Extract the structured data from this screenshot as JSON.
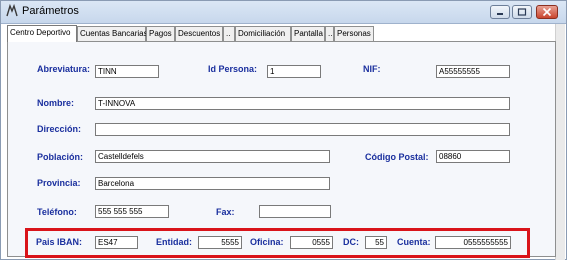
{
  "window": {
    "title": "Parámetros"
  },
  "tabs": [
    {
      "label": "Centro Deportivo",
      "active": true
    },
    {
      "label": "Cuentas Bancarias",
      "active": false
    },
    {
      "label": "Pagos",
      "active": false
    },
    {
      "label": "Descuentos",
      "active": false
    },
    {
      "label": "..",
      "active": false
    },
    {
      "label": "Domiciliación",
      "active": false
    },
    {
      "label": "Pantalla",
      "active": false
    },
    {
      "label": "..",
      "active": false
    },
    {
      "label": "Personas",
      "active": false
    }
  ],
  "form": {
    "abreviatura": {
      "label": "Abreviatura:",
      "value": "TINN"
    },
    "id_persona": {
      "label": "Id Persona:",
      "value": "1"
    },
    "nif": {
      "label": "NIF:",
      "value": "A55555555"
    },
    "nombre": {
      "label": "Nombre:",
      "value": "T-INNOVA"
    },
    "direccion": {
      "label": "Dirección:",
      "value": ""
    },
    "poblacion": {
      "label": "Población:",
      "value": "Castelldefels"
    },
    "codigo_postal": {
      "label": "Código Postal:",
      "value": "08860"
    },
    "provincia": {
      "label": "Provincia:",
      "value": "Barcelona"
    },
    "telefono": {
      "label": "Teléfono:",
      "value": "555 555 555"
    },
    "fax": {
      "label": "Fax:",
      "value": ""
    },
    "pais_iban": {
      "label": "Pais IBAN:",
      "value": "ES47"
    },
    "entidad": {
      "label": "Entidad:",
      "value": "5555"
    },
    "oficina": {
      "label": "Oficina:",
      "value": "0555"
    },
    "dc": {
      "label": "DC:",
      "value": "55"
    },
    "cuenta": {
      "label": "Cuenta:",
      "value": "0555555555"
    }
  },
  "colors": {
    "label": "#1a2f9e",
    "highlight": "#d9141a"
  }
}
